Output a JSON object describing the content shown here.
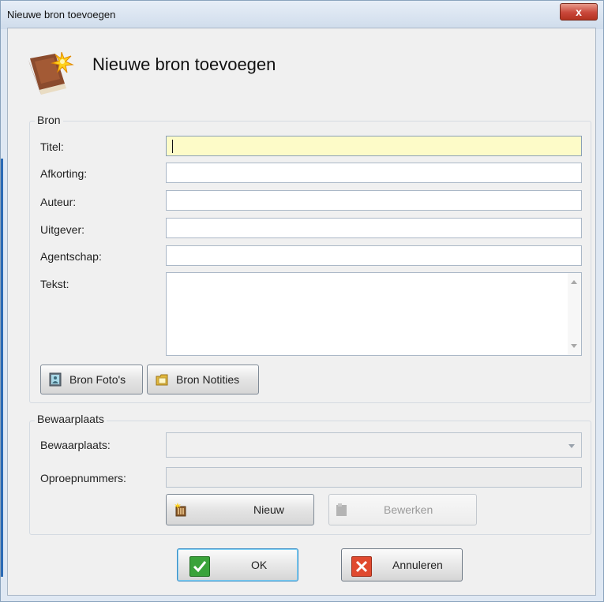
{
  "window": {
    "title": "Nieuwe bron toevoegen",
    "close_glyph": "x"
  },
  "header": {
    "title": "Nieuwe bron toevoegen",
    "icon": "book-icon"
  },
  "bron_group": {
    "label": "Bron",
    "fields": {
      "titel_label": "Titel:",
      "titel_value": "",
      "afkorting_label": "Afkorting:",
      "afkorting_value": "",
      "auteur_label": "Auteur:",
      "auteur_value": "",
      "uitgever_label": "Uitgever:",
      "uitgever_value": "",
      "agentschap_label": "Agentschap:",
      "agentschap_value": "",
      "tekst_label": "Tekst:",
      "tekst_value": ""
    },
    "buttons": {
      "fotos_label": "Bron Foto's",
      "notities_label": "Bron Notities"
    }
  },
  "bewaar_group": {
    "label": "Bewaarplaats",
    "bewaarplaats_label": "Bewaarplaats:",
    "bewaarplaats_value": "",
    "oproep_label": "Oproepnummers:",
    "oproep_value": "",
    "nieuw_label": "Nieuw",
    "bewerken_label": "Bewerken"
  },
  "footer": {
    "ok_label": "OK",
    "cancel_label": "Annuleren"
  },
  "colors": {
    "active_field": "#fdfbc8",
    "ok_green": "#3aa33a",
    "cancel_red": "#e04a2f",
    "titlebar": "#dbe5f1"
  }
}
